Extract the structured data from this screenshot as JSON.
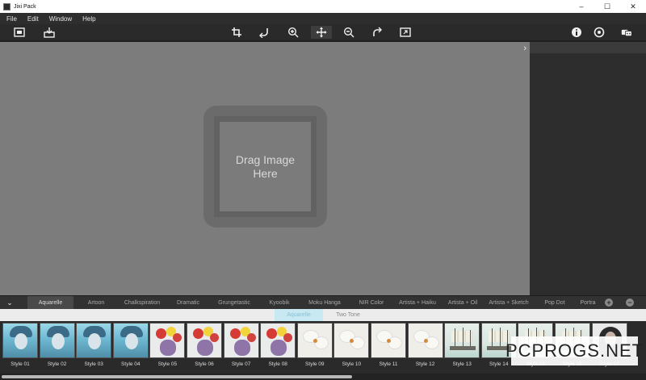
{
  "window": {
    "title": "Jixi Pack",
    "controls": [
      "–",
      "☐",
      "✕"
    ]
  },
  "menu": [
    "File",
    "Edit",
    "Window",
    "Help"
  ],
  "toolbar": {
    "left_icons": [
      "open-image-icon",
      "save-export-icon"
    ],
    "center_icons": [
      "crop-icon",
      "rotate-left-icon",
      "zoom-in-icon",
      "move-icon",
      "zoom-out-icon",
      "redo-icon",
      "fit-screen-icon"
    ],
    "right_icons": [
      "info-icon",
      "settings-icon",
      "store-icon"
    ],
    "active_tool": "move-icon"
  },
  "canvas": {
    "drop_text_line1": "Drag Image",
    "drop_text_line2": "Here",
    "panel_toggle": "›"
  },
  "style_tabs": {
    "items": [
      "Aquarelle",
      "Artoon",
      "Chalkspiration",
      "Dramatic",
      "Grungetastic",
      "Kyoobik",
      "Moku Hanga",
      "NIR Color",
      "Artista + Haiku",
      "Artista + Oil",
      "Artista + Sketch",
      "Pop Dot",
      "Portra"
    ],
    "active_index": 0,
    "add_label": "+",
    "remove_label": "−",
    "collapse_label": "⌄"
  },
  "sub_tabs": {
    "items": [
      "Aquarelle",
      "Two Tone"
    ],
    "active_index": 0
  },
  "thumbnails": [
    {
      "label": "Style 01",
      "kind": "portrait"
    },
    {
      "label": "Style 02",
      "kind": "portrait"
    },
    {
      "label": "Style 03",
      "kind": "portrait"
    },
    {
      "label": "Style 04",
      "kind": "portrait"
    },
    {
      "label": "Style 05",
      "kind": "flower"
    },
    {
      "label": "Style 06",
      "kind": "flower"
    },
    {
      "label": "Style 07",
      "kind": "flower"
    },
    {
      "label": "Style 08",
      "kind": "flower"
    },
    {
      "label": "Style 09",
      "kind": "orchid"
    },
    {
      "label": "Style 10",
      "kind": "orchid"
    },
    {
      "label": "Style 11",
      "kind": "orchid"
    },
    {
      "label": "Style 12",
      "kind": "orchid"
    },
    {
      "label": "Style 13",
      "kind": "ship"
    },
    {
      "label": "Style 14",
      "kind": "ship"
    },
    {
      "label": "Style 15",
      "kind": "ship"
    },
    {
      "label": "Style 16",
      "kind": "ship"
    },
    {
      "label": "Style 17",
      "kind": "woman"
    }
  ],
  "watermark": "PCPROGS.NET",
  "colors": {
    "canvas_bg": "#7c7c7c",
    "drop_zone": "#6b6b6b",
    "active_subtab": "#c8e8f2",
    "panel_bg": "#2d2d2d"
  }
}
